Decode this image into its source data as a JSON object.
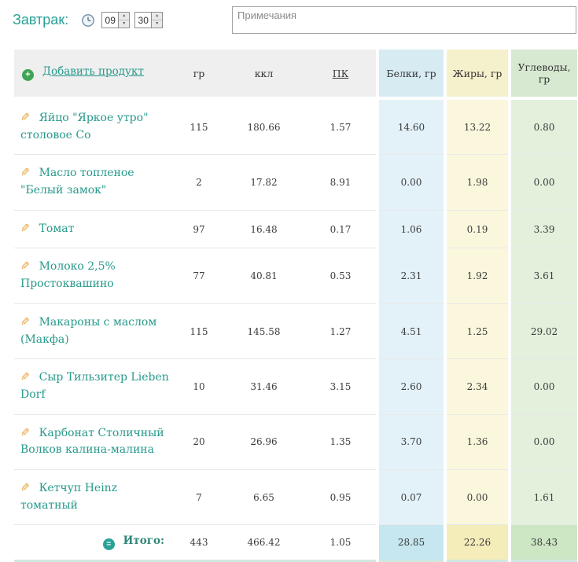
{
  "meal": {
    "title": "Завтрак:",
    "time_hours": "09",
    "time_minutes": "30",
    "notes_placeholder": "Примечания"
  },
  "icons": {
    "add": "+",
    "equals": "=",
    "pencil": "✎",
    "up": "▲",
    "down": "▼"
  },
  "colors": {
    "accent_teal": "#27a095",
    "protein_col": "#e3f2f8",
    "fat_col": "#fbf7dc",
    "carbs_col": "#e2f0dc",
    "pencil_orange": "#e6a23c"
  },
  "table": {
    "add_product_label": "Добавить продукт",
    "headers": [
      "гр",
      "ккл",
      "ПК",
      "Белки, гр",
      "Жиры, гр",
      "Углеводы, гр"
    ],
    "rows": [
      {
        "name": "Яйцо \"Яркое утро\" столовое Со",
        "gr": "115",
        "kcal": "180.66",
        "pk": "1.57",
        "protein": "14.60",
        "fat": "13.22",
        "carbs": "0.80"
      },
      {
        "name": "Масло топленое \"Белый замок\"",
        "gr": "2",
        "kcal": "17.82",
        "pk": "8.91",
        "protein": "0.00",
        "fat": "1.98",
        "carbs": "0.00"
      },
      {
        "name": "Томат",
        "gr": "97",
        "kcal": "16.48",
        "pk": "0.17",
        "protein": "1.06",
        "fat": "0.19",
        "carbs": "3.39"
      },
      {
        "name": "Молоко 2,5% Простоквашино",
        "gr": "77",
        "kcal": "40.81",
        "pk": "0.53",
        "protein": "2.31",
        "fat": "1.92",
        "carbs": "3.61"
      },
      {
        "name": "Макароны с маслом (Макфа)",
        "gr": "115",
        "kcal": "145.58",
        "pk": "1.27",
        "protein": "4.51",
        "fat": "1.25",
        "carbs": "29.02"
      },
      {
        "name": "Сыр Тильзитер Lieben Dorf",
        "gr": "10",
        "kcal": "31.46",
        "pk": "3.15",
        "protein": "2.60",
        "fat": "2.34",
        "carbs": "0.00"
      },
      {
        "name": "Карбонат Столичный Волков калина-малина",
        "gr": "20",
        "kcal": "26.96",
        "pk": "1.35",
        "protein": "3.70",
        "fat": "1.36",
        "carbs": "0.00"
      },
      {
        "name": "Кетчуп Heinz томатный",
        "gr": "7",
        "kcal": "6.65",
        "pk": "0.95",
        "protein": "0.07",
        "fat": "0.00",
        "carbs": "1.61"
      }
    ],
    "total": {
      "label": "Итого:",
      "gr": "443",
      "kcal": "466.42",
      "pk": "1.05",
      "protein": "28.85",
      "fat": "22.26",
      "carbs": "38.43"
    }
  }
}
